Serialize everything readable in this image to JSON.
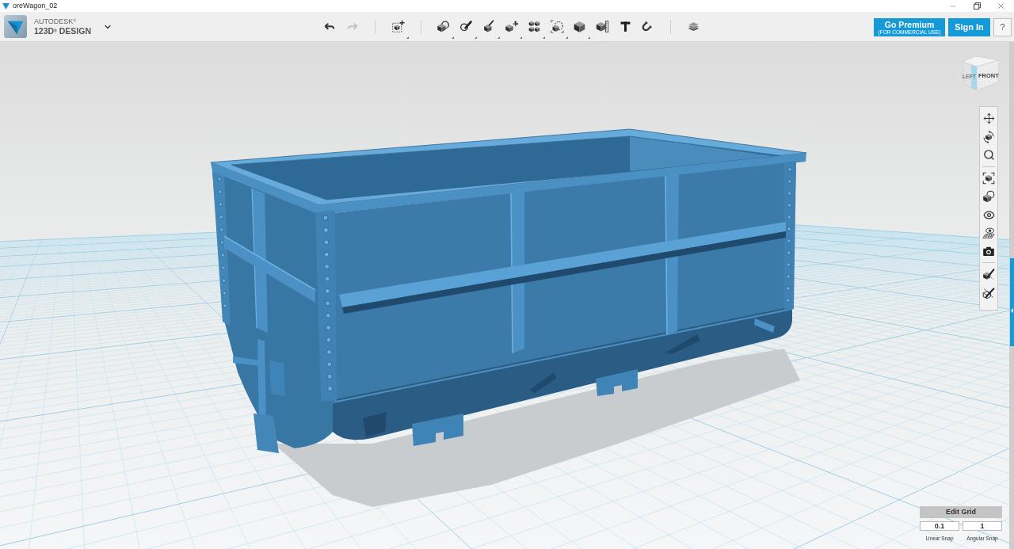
{
  "window": {
    "title": "oreWagon_02"
  },
  "header": {
    "brand": "AUTODESK$^{®}$",
    "product": "123D$^{®}$ DESIGN",
    "premium_button": {
      "label": "Go Premium",
      "sublabel": "(FOR COMMERCIAL USE)"
    },
    "sign_in_button": "Sign In",
    "help_button": "?"
  },
  "toolbar": {
    "undo": {
      "disabled": false
    },
    "redo": {
      "disabled": true
    }
  },
  "view_cube": {
    "left_face": "LEFT",
    "front_face": "FRONT"
  },
  "edit_grid": {
    "title": "Edit Grid",
    "fields": [
      {
        "value": "0.1",
        "label": "Linear Snap"
      },
      {
        "value": "1",
        "label": "Angular Snap"
      }
    ]
  }
}
